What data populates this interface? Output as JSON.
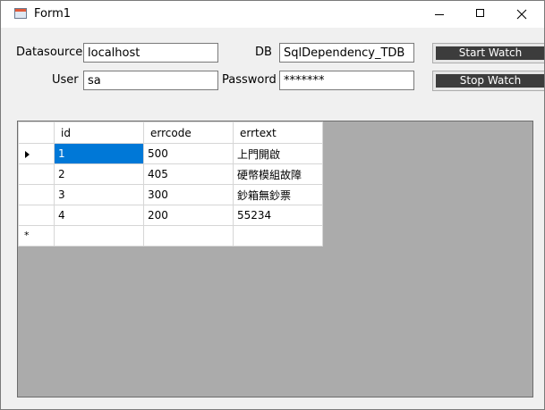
{
  "window": {
    "title": "Form1"
  },
  "form": {
    "datasource_label": "Datasource",
    "datasource_value": "localhost",
    "db_label": "DB",
    "db_value": "SqlDependency_TDB",
    "user_label": "User",
    "user_value": "sa",
    "password_label": "Password",
    "password_value": "*******",
    "start_label": "Start Watch",
    "stop_label": "Stop Watch"
  },
  "grid": {
    "columns": [
      "id",
      "errcode",
      "errtext"
    ],
    "rows": [
      [
        "1",
        "500",
        "上門開啟"
      ],
      [
        "2",
        "405",
        "硬幣模組故障"
      ],
      [
        "3",
        "300",
        "鈔箱無鈔票"
      ],
      [
        "4",
        "200",
        "55234"
      ]
    ],
    "current_row_marker": "▶",
    "new_row_marker": "*"
  },
  "icons": {
    "app": "app-window-icon",
    "minimize": "minimize-icon",
    "maximize": "maximize-icon",
    "close": "close-icon",
    "current_row": "row-pointer-icon",
    "new_row": "new-row-icon"
  },
  "colors": {
    "selection": "#0078d7",
    "grid_background": "#ababab",
    "button_face": "#3c3c3c"
  }
}
